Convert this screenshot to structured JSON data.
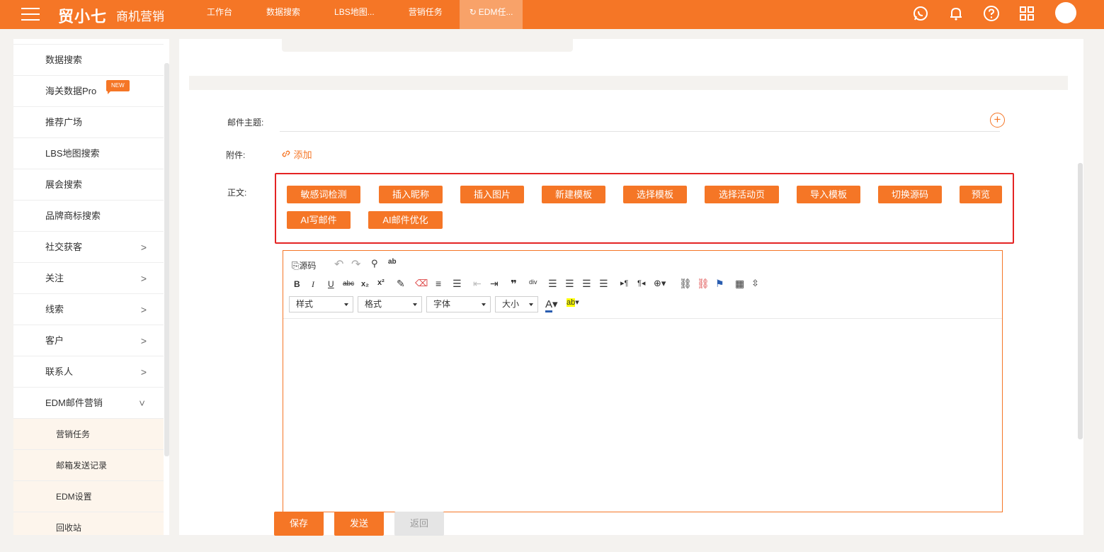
{
  "topbar": {
    "brand": "贸小七",
    "subtitle": "商机营销",
    "tabs": [
      {
        "label": "工作台"
      },
      {
        "label": "数据搜索"
      },
      {
        "label": "LBS地图..."
      },
      {
        "label": "营销任务"
      },
      {
        "label": "EDM任..."
      }
    ],
    "icons": [
      "whatsapp-icon",
      "bell-icon",
      "help-icon",
      "apps-grid-icon",
      "avatar"
    ]
  },
  "sidebar": {
    "items": [
      {
        "label": "数据搜索"
      },
      {
        "label": "海关数据Pro",
        "badge": "NEW"
      },
      {
        "label": "推荐广场"
      },
      {
        "label": "LBS地图搜索"
      },
      {
        "label": "展会搜索"
      },
      {
        "label": "品牌商标搜索"
      },
      {
        "label": "社交获客"
      },
      {
        "label": "关注"
      },
      {
        "label": "线索"
      },
      {
        "label": "客户"
      },
      {
        "label": "联系人"
      },
      {
        "label": "EDM邮件营销"
      }
    ],
    "sub_items": [
      {
        "label": "营销任务"
      },
      {
        "label": "邮箱发送记录"
      },
      {
        "label": "EDM设置"
      },
      {
        "label": "回收站"
      }
    ]
  },
  "form": {
    "subject_label": "邮件主题:",
    "attachment_label": "附件:",
    "attachment_add": "添加",
    "body_label": "正文:"
  },
  "action_buttons": [
    "敏感词检测",
    "插入昵称",
    "插入图片",
    "新建模板",
    "选择模板",
    "选择活动页",
    "导入模板",
    "切换源码",
    "预览",
    "AI写邮件",
    "AI邮件优化"
  ],
  "editor": {
    "source_label": "源码",
    "dropdowns": [
      "样式",
      "格式",
      "字体",
      "大小"
    ]
  },
  "footer": {
    "save": "保存",
    "send": "发送",
    "back": "返回"
  },
  "colors": {
    "accent": "#f57626",
    "highlight_border": "#e42424",
    "disabled": "#e5e5e5"
  }
}
